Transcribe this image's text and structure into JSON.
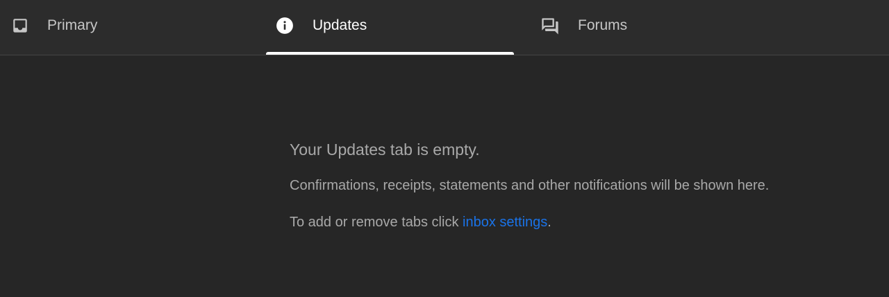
{
  "tabs": {
    "primary": {
      "label": "Primary",
      "icon": "inbox-icon"
    },
    "updates": {
      "label": "Updates",
      "icon": "info-icon",
      "selected": true
    },
    "forums": {
      "label": "Forums",
      "icon": "forum-icon"
    }
  },
  "empty_state": {
    "title": "Your Updates tab is empty.",
    "description": "Confirmations, receipts, statements and other notifications will be shown here.",
    "hint_prefix": "To add or remove tabs click ",
    "link_text": "inbox settings",
    "hint_suffix": "."
  },
  "colors": {
    "background": "#262626",
    "tabbar": "#2c2c2c",
    "text_muted": "#a9a9a9",
    "link": "#1a73e8",
    "active": "#ffffff"
  }
}
